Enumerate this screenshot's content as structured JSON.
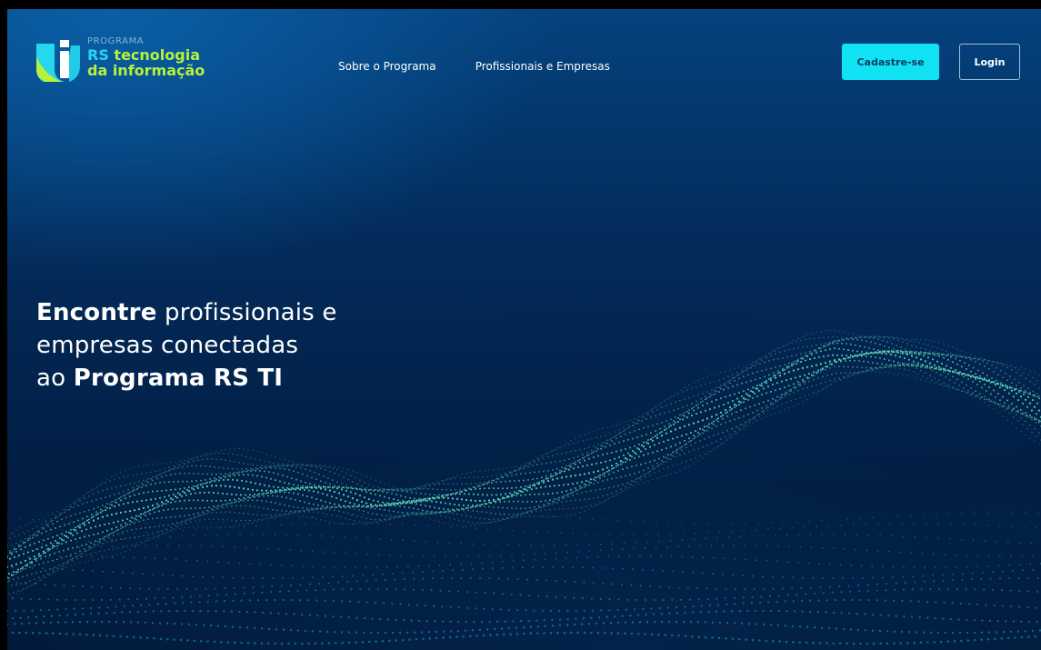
{
  "brand": {
    "kicker": "PROGRAMA",
    "line1_highlight": "RS",
    "line1_rest": " tecnologia",
    "line2": "da informação",
    "colors": {
      "cyan": "#27d7f0",
      "lime": "#b7f23a"
    },
    "icon": "rs-ti-logo-mark"
  },
  "nav": {
    "items": [
      {
        "label": "Sobre o Programa"
      },
      {
        "label": "Profissionais e Empresas"
      }
    ]
  },
  "actions": {
    "signup_label": "Cadastre-se",
    "login_label": "Login",
    "signup_color": "#11e2f3"
  },
  "hero": {
    "bold1": "Encontre",
    "text1": " profissionais e",
    "text2": "empresas conectadas",
    "text3": "ao ",
    "bold2": "Programa RS TI"
  },
  "decor": {
    "wave_colors": [
      "#a8ff3c",
      "#2fe0e8",
      "#1ad1f2",
      "#ff6a1a"
    ],
    "icon": "particle-wave"
  }
}
